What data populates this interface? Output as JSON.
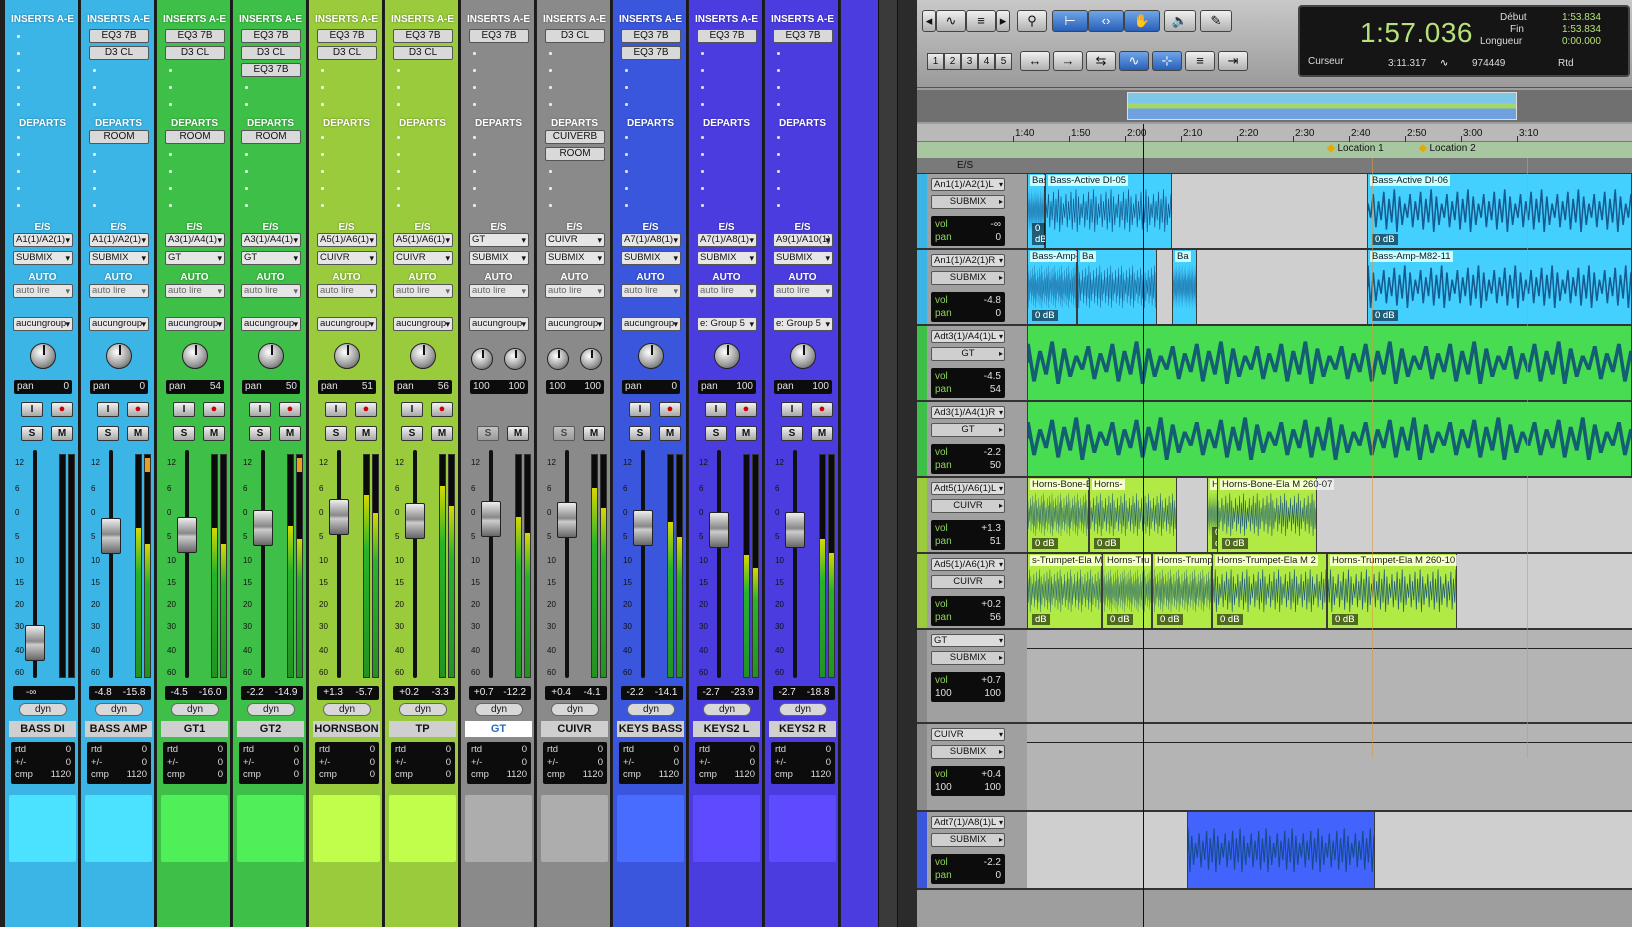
{
  "colors": {
    "bass": "#3bb5e6",
    "gt": "#3ebf47",
    "horn": "#8cc63f",
    "grey": "#8a8a8a",
    "keys": "#3a56dc",
    "keys2": "#4b3ce0"
  },
  "mixer": {
    "labels": {
      "inserts": "INSERTS A-E",
      "departs": "DEPARTS",
      "es": "E/S",
      "auto": "AUTO",
      "rtd": "rtd",
      "pm": "+/-",
      "cmp": "cmp",
      "dyn": "dyn",
      "pan": "pan"
    },
    "scale": [
      "12",
      "6",
      "0",
      "5",
      "10",
      "15",
      "20",
      "30",
      "40",
      "60"
    ],
    "strips": [
      {
        "name": "BASS DI",
        "color": "#3bb5e6",
        "inserts": [],
        "departs": [],
        "io": "A1(1)/A2(1)",
        "out": "SUBMIX",
        "auto": "auto lire",
        "group": "aucungroup",
        "pan": "0",
        "vol": "-∞",
        "peak": "",
        "rtd": "0",
        "pm": "0",
        "cmp": "1120",
        "knobs": 1
      },
      {
        "name": "BASS AMP",
        "color": "#3bb5e6",
        "inserts": [
          "EQ3 7B",
          "D3 CL"
        ],
        "departs": [
          "ROOM"
        ],
        "io": "A1(1)/A2(1)",
        "out": "SUBMIX",
        "auto": "auto lire",
        "group": "aucungroup",
        "pan": "0",
        "vol": "-4.8",
        "peak": "-15.8",
        "rtd": "0",
        "pm": "0",
        "cmp": "1120",
        "knobs": 1
      },
      {
        "name": "GT1",
        "color": "#3ebf47",
        "inserts": [
          "EQ3 7B",
          "D3 CL"
        ],
        "departs": [
          "ROOM"
        ],
        "io": "A3(1)/A4(1)",
        "out": "GT",
        "auto": "auto lire",
        "group": "aucungroup",
        "pan": "54",
        "vol": "-4.5",
        "peak": "-16.0",
        "rtd": "0",
        "pm": "0",
        "cmp": "0",
        "knobs": 1
      },
      {
        "name": "GT2",
        "color": "#3ebf47",
        "inserts": [
          "EQ3 7B",
          "D3 CL",
          "EQ3 7B"
        ],
        "departs": [
          "ROOM"
        ],
        "io": "A3(1)/A4(1)",
        "out": "GT",
        "auto": "auto lire",
        "group": "aucungroup",
        "pan": "50",
        "vol": "-2.2",
        "peak": "-14.9",
        "rtd": "0",
        "pm": "0",
        "cmp": "0",
        "knobs": 1
      },
      {
        "name": "HORNSBON",
        "color": "#9acb3c",
        "inserts": [
          "EQ3 7B",
          "D3 CL"
        ],
        "departs": [],
        "io": "A5(1)/A6(1)",
        "out": "CUIVR",
        "auto": "auto lire",
        "group": "aucungroup",
        "pan": "51",
        "vol": "+1.3",
        "peak": "-5.7",
        "rtd": "0",
        "pm": "0",
        "cmp": "0",
        "knobs": 1
      },
      {
        "name": "TP",
        "color": "#9acb3c",
        "inserts": [
          "EQ3 7B",
          "D3 CL"
        ],
        "departs": [],
        "io": "A5(1)/A6(1)",
        "out": "CUIVR",
        "auto": "auto lire",
        "group": "aucungroup",
        "pan": "56",
        "vol": "+0.2",
        "peak": "-3.3",
        "rtd": "0",
        "pm": "0",
        "cmp": "0",
        "knobs": 1
      },
      {
        "name": "GT",
        "color": "#8a8a8a",
        "inserts": [
          "EQ3 7B"
        ],
        "departs": [],
        "io": "GT",
        "out": "SUBMIX",
        "auto": "auto lire",
        "group": "aucungroup",
        "pan": "100",
        "pan2": "100",
        "vol": "+0.7",
        "peak": "-12.2",
        "rtd": "0",
        "pm": "0",
        "cmp": "1120",
        "knobs": 2,
        "hl": true
      },
      {
        "name": "CUIVR",
        "color": "#8a8a8a",
        "inserts": [
          "D3 CL"
        ],
        "departs": [
          "CUIVERB",
          "ROOM"
        ],
        "io": "CUIVR",
        "out": "SUBMIX",
        "auto": "auto lire",
        "group": "aucungroup",
        "pan": "100",
        "pan2": "100",
        "vol": "+0.4",
        "peak": "-4.1",
        "rtd": "0",
        "pm": "0",
        "cmp": "1120",
        "knobs": 2
      },
      {
        "name": "KEYS BASS",
        "color": "#3a56dc",
        "inserts": [
          "EQ3 7B",
          "EQ3 7B"
        ],
        "departs": [],
        "io": "A7(1)/A8(1)",
        "out": "SUBMIX",
        "auto": "auto lire",
        "group": "aucungroup",
        "pan": "0",
        "vol": "-2.2",
        "peak": "-14.1",
        "rtd": "0",
        "pm": "0",
        "cmp": "1120",
        "knobs": 1
      },
      {
        "name": "KEYS2 L",
        "color": "#4b3ce0",
        "inserts": [
          "EQ3 7B"
        ],
        "departs": [],
        "io": "A7(1)/A8(1)",
        "out": "SUBMIX",
        "auto": "auto lire",
        "group": "e: Group 5",
        "pan": "100",
        "vol": "-2.7",
        "peak": "-23.9",
        "rtd": "0",
        "pm": "0",
        "cmp": "1120",
        "knobs": 1
      },
      {
        "name": "KEYS2 R",
        "color": "#4b3ce0",
        "inserts": [
          "EQ3 7B"
        ],
        "departs": [],
        "io": "A9(1)/A10(1)",
        "out": "SUBMIX",
        "auto": "auto lire",
        "group": "e: Group 5",
        "pan": "100",
        "vol": "-2.7",
        "peak": "-18.8",
        "rtd": "0",
        "pm": "0",
        "cmp": "1120",
        "knobs": 1
      }
    ]
  },
  "edit": {
    "toolbar": {
      "nums": [
        "1",
        "2",
        "3",
        "4",
        "5"
      ]
    },
    "counter": {
      "main": "1:57.036",
      "debut_label": "Début",
      "debut": "1:53.834",
      "fin_label": "Fin",
      "fin": "1:53.834",
      "longueur_label": "Longueur",
      "longueur": "0:00.000",
      "curseur_label": "Curseur",
      "curseur": "3:11.317",
      "samples": "974449",
      "rtd": "Rtd"
    },
    "ruler": [
      "1:40",
      "1:50",
      "2:00",
      "2:10",
      "2:20",
      "2:30",
      "2:40",
      "2:50",
      "3:00",
      "3:10"
    ],
    "markers": [
      "Location 1",
      "Location 2"
    ],
    "es_label": "E/S",
    "tracks": [
      {
        "io": "An1(1)/A2(1)L",
        "out": "SUBMIX",
        "vol": "-∞",
        "pan": "0",
        "color": "#3bb5e6",
        "clips": [
          {
            "name": "Bass",
            "db": "0 dB"
          },
          {
            "name": "Bass-Active DI-05",
            "db": ""
          },
          {
            "name": "Bass-Active DI-06",
            "db": "0 dB"
          }
        ]
      },
      {
        "io": "An1(1)/A2(1)R",
        "out": "SUBMIX",
        "vol": "-4.8",
        "pan": "0",
        "color": "#3bb5e6",
        "clips": [
          {
            "name": "Bass-Amp-M8",
            "db": "0 dB"
          },
          {
            "name": "Ba",
            "db": ""
          },
          {
            "name": "Ba",
            "db": ""
          },
          {
            "name": "Bass-Amp-M82-11",
            "db": "0 dB"
          }
        ]
      },
      {
        "io": "Adt3(1)/A4(1)L",
        "out": "GT",
        "vol": "-4.5",
        "pan": "54",
        "color": "#3ebf47",
        "clips": []
      },
      {
        "io": "Ad3(1)/A4(1)R",
        "out": "GT",
        "vol": "-2.2",
        "pan": "50",
        "color": "#3ebf47",
        "clips": []
      },
      {
        "io": "Adt5(1)/A6(1)L",
        "out": "CUIVR",
        "vol": "+1.3",
        "pan": "51",
        "color": "#9acb3c",
        "clips": [
          {
            "name": "Horns-Bone-Ela M",
            "db": "0 dB"
          },
          {
            "name": "Horns-",
            "db": "0 dB"
          },
          {
            "name": "Horns-E",
            "db": "0 dE"
          },
          {
            "name": "Horns-Bone-Ela M 260-07",
            "db": "0 dB"
          }
        ]
      },
      {
        "io": "Ad5(1)/A6(1)R",
        "out": "CUIVR",
        "vol": "+0.2",
        "pan": "56",
        "color": "#9acb3c",
        "clips": [
          {
            "name": "s-Trumpet-Ela M",
            "db": "dB"
          },
          {
            "name": "Horns-Tru",
            "db": "0 dB"
          },
          {
            "name": "Horns-Trump",
            "db": "0 dB"
          },
          {
            "name": "Horns-Trumpet-Ela M 2",
            "db": "0 dB"
          },
          {
            "name": "Horns-Trumpet-Ela M 260-10",
            "db": "0 dB"
          }
        ]
      },
      {
        "io": "GT",
        "out": "SUBMIX",
        "vol": "+0.7",
        "pan": "100",
        "pan2": "100",
        "color": "#8a8a8a",
        "clips": []
      },
      {
        "io": "CUIVR",
        "out": "SUBMIX",
        "vol": "+0.4",
        "pan": "100",
        "pan2": "100",
        "color": "#8a8a8a",
        "clips": []
      },
      {
        "io": "Adt7(1)/A8(1)L",
        "out": "SUBMIX",
        "vol": "-2.2",
        "pan": "0",
        "color": "#3a56dc",
        "clips": []
      }
    ],
    "vol_label": "vol",
    "pan_label": "pan"
  }
}
